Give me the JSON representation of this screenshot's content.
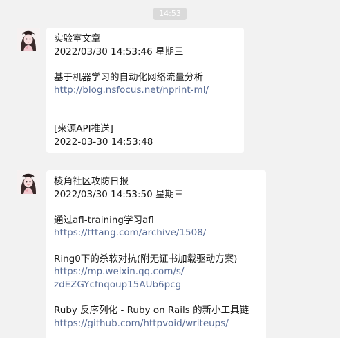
{
  "time_divider": "14:53",
  "messages": [
    {
      "sender_avatar": "avatar-girl",
      "lines": {
        "title": "实验室文章",
        "date": "2022/03/30 14:53:46 星期三",
        "article": "基于机器学习的自动化网络流量分析",
        "article_link": "http://blog.nsfocus.net/nprint-ml/",
        "source": "[来源API推送]",
        "source_time": "2022-03-30 14:53:48"
      }
    },
    {
      "sender_avatar": "avatar-girl",
      "lines": {
        "title": "棱角社区攻防日报",
        "date": "2022/03/30 14:53:50 星期三",
        "item1": "通过afl-training学习afl",
        "item1_link": "https://tttang.com/archive/1508/",
        "item2": "Ring0下的杀软对抗(附无证书加载驱动方案)",
        "item2_link_1": "https://mp.weixin.qq.com/s/",
        "item2_link_2": "zdEZGYcfnqoup15AUb6pcg",
        "item3": "Ruby 反序列化 - Ruby on Rails 的新小工具链",
        "item3_link": "https://github.com/httpvoid/writeups/"
      }
    }
  ],
  "colors": {
    "background": "#f2f2f2",
    "bubble": "#ffffff",
    "text": "#1a1a1a",
    "link": "#576b95",
    "time_chip": "#dadada"
  }
}
